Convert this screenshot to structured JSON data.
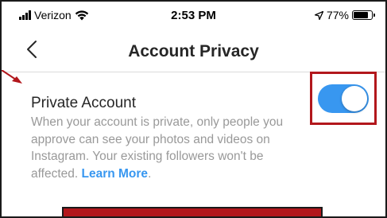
{
  "status_bar": {
    "carrier": "Verizon",
    "time": "2:53 PM",
    "battery": "77%",
    "battery_level": 0.77,
    "signal_icon": "signal-bars-icon",
    "wifi_icon": "wifi-icon",
    "location_icon": "location-arrow-icon",
    "battery_icon": "battery-icon"
  },
  "nav": {
    "title": "Account Privacy",
    "back_icon": "chevron-left-icon"
  },
  "setting": {
    "title": "Private Account",
    "description": "When your account is private, only people you approve can see your photos and videos on Instagram. Your existing followers won't be affected.",
    "learn_more": "Learn More",
    "learn_more_suffix": ".",
    "toggle_on": true
  },
  "colors": {
    "accent": "#3897f0",
    "annotation_red": "#b2171c",
    "text_primary": "#262626",
    "text_secondary": "#999999"
  }
}
